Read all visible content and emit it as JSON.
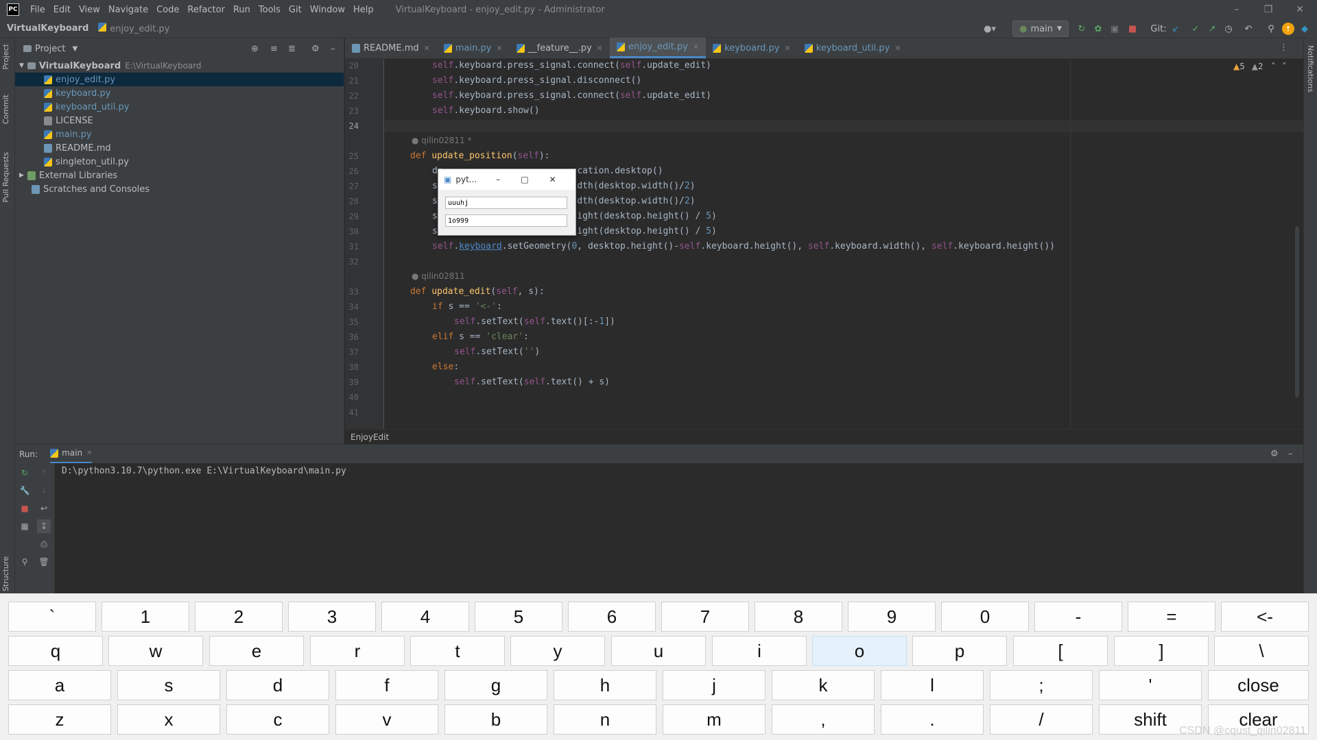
{
  "menubar": {
    "logo": "PC",
    "items": [
      "File",
      "Edit",
      "View",
      "Navigate",
      "Code",
      "Refactor",
      "Run",
      "Tools",
      "Git",
      "Window",
      "Help"
    ],
    "window_title": "VirtualKeyboard - enjoy_edit.py - Administrator"
  },
  "navbar": {
    "project": "VirtualKeyboard",
    "file": "enjoy_edit.py",
    "branch": "main",
    "git_label": "Git:"
  },
  "left_strip": {
    "project": "Project",
    "commit": "Commit",
    "pull_requests": "Pull Requests",
    "structure": "Structure"
  },
  "right_strip": {
    "notifications": "Notifications"
  },
  "project_panel": {
    "title": "Project",
    "root_name": "VirtualKeyboard",
    "root_path": "E:\\VirtualKeyboard",
    "files": [
      {
        "name": "enjoy_edit.py",
        "type": "py"
      },
      {
        "name": "keyboard.py",
        "type": "py"
      },
      {
        "name": "keyboard_util.py",
        "type": "py"
      },
      {
        "name": "LICENSE",
        "type": "txt"
      },
      {
        "name": "main.py",
        "type": "py"
      },
      {
        "name": "README.md",
        "type": "md"
      },
      {
        "name": "singleton_util.py",
        "type": "py"
      }
    ],
    "external_libraries": "External Libraries",
    "scratches": "Scratches and Consoles"
  },
  "tabs": [
    {
      "label": "README.md"
    },
    {
      "label": "main.py"
    },
    {
      "label": "__feature__.py"
    },
    {
      "label": "enjoy_edit.py"
    },
    {
      "label": "keyboard.py"
    },
    {
      "label": "keyboard_util.py"
    }
  ],
  "editor": {
    "warnings": "5",
    "weak_warnings": "2",
    "line_numbers": [
      "20",
      "21",
      "22",
      "23",
      "24",
      "25",
      "26",
      "27",
      "28",
      "29",
      "30",
      "31",
      "32",
      "33",
      "34",
      "35",
      "36",
      "37",
      "38",
      "39",
      "40",
      "41"
    ],
    "author": "qilin02811",
    "author_modified": "qilin02811 *",
    "breadcrumb": "EnjoyEdit"
  },
  "run": {
    "label": "Run:",
    "config": "main",
    "command": "D:\\python3.10.7\\python.exe E:\\VirtualKeyboard\\main.py"
  },
  "popup": {
    "title": "pyt...",
    "field1": "uuuhj",
    "field2": "1o999"
  },
  "keyboard": {
    "rows": [
      [
        "`",
        "1",
        "2",
        "3",
        "4",
        "5",
        "6",
        "7",
        "8",
        "9",
        "0",
        "-",
        "=",
        "<-"
      ],
      [
        "q",
        "w",
        "e",
        "r",
        "t",
        "y",
        "u",
        "i",
        "o",
        "p",
        "[",
        "]",
        "\\"
      ],
      [
        "a",
        "s",
        "d",
        "f",
        "g",
        "h",
        "j",
        "k",
        "l",
        ";",
        "'",
        "close"
      ],
      [
        "z",
        "x",
        "c",
        "v",
        "b",
        "n",
        "m",
        ",",
        ".",
        "/",
        "shift",
        "clear"
      ]
    ]
  },
  "watermark": "CSDN @cqust_qilin02811"
}
